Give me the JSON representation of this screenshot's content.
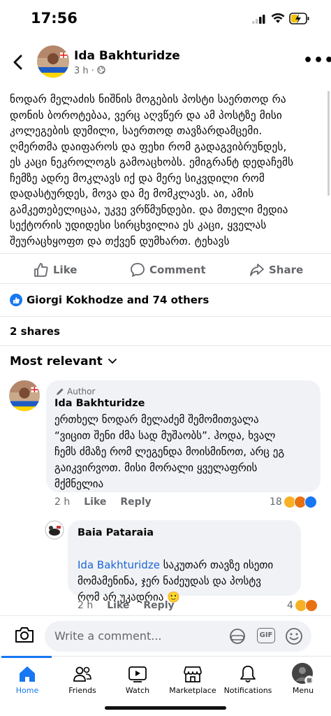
{
  "status": {
    "time": "17:56"
  },
  "header": {
    "name": "Ida Bakhturidze",
    "time": "3 h ·",
    "globe_icon": "globe-icon",
    "more_icon": "more-options-icon"
  },
  "post": {
    "text": "ნოდარ მელაძის ნიშნის მოგების პოსტი საერთოდ რა\nდონის ბოროტებაა, ვერც აღვწერ და ამ პოსტზე მისი\nკოლეგების დუმილი, საერთოდ თავზარდამცემი.\nღმერთმა დაიფაროს და ფეხი რომ გადაგვიბრუნდეს,\nეს კაცი ნეკროლოგს გამოაცხობს. ემიგრანტ დედაჩემს\nჩემზე ადრე მოკლავს იქ და მერე სიკვდილი რომ\nდადასტურდეს, მოვა და მე მომკლავს. აი, ამის\nგამკეთებელიცაა, უკვე ვრწმუნდები. და მთელი მედია\nსექტორის უდიდესი სირცხვილია ეს კაცი, ყველას\nშეურაცხყოფთ და თქვენ დუმხართ. ტეხავს"
  },
  "actions": {
    "like": "Like",
    "comment": "Comment",
    "share": "Share"
  },
  "reactions": {
    "summary": "Giorgi Kokhodze and 74 others"
  },
  "shares": "2 shares",
  "sort": {
    "label": "Most relevant"
  },
  "comments": [
    {
      "badge": "Author",
      "name": "Ida Bakhturidze",
      "text": "ერთხელ ნოდარ მელაძემ შემომითვალა\n“ვიცით შენი ძმა სად მუშაობს”. ჰოდა, ხვალ\nჩემს ძმაზე რომ ლეგენდა მოისმინოთ, არც ეგ\nგაიკვირვოთ. მისი მორალი ყველაფრის\nმქმნელია",
      "time": "2 h",
      "like": "Like",
      "reply": "Reply",
      "count": "18"
    },
    {
      "name": "Baia Pataraia",
      "mention": "Ida Bakhturidze",
      "text": " საკუთარ თავზე ისეთი\nმომამენინა, ჯერ ნაძეუდას და პოსტვ\nრომ არ უკადრია 🙂",
      "time": "2 h",
      "like": "Like",
      "reply": "Reply",
      "count": "4"
    }
  ],
  "composer": {
    "placeholder": "Write a comment..."
  },
  "tabs": [
    {
      "label": "Home",
      "icon": "home-icon"
    },
    {
      "label": "Friends",
      "icon": "friends-icon"
    },
    {
      "label": "Watch",
      "icon": "watch-icon"
    },
    {
      "label": "Marketplace",
      "icon": "marketplace-icon"
    },
    {
      "label": "Notifications",
      "icon": "bell-icon"
    },
    {
      "label": "Menu",
      "icon": "menu-avatar-icon"
    }
  ],
  "colors": {
    "accent": "#1877f2",
    "muted": "#65676b",
    "bubble": "#f0f2f5",
    "angry": "#e9710f",
    "wow": "#f7b125"
  }
}
